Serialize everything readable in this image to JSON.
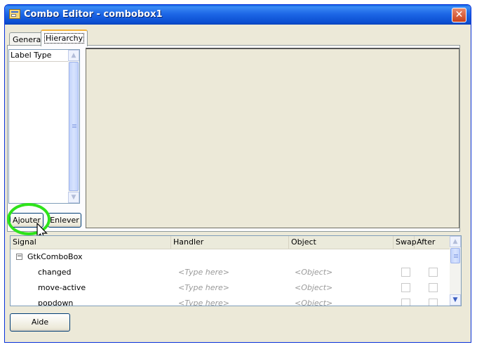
{
  "window": {
    "title": "Combo Editor - combobox1",
    "close_glyph": "✕"
  },
  "tabs": [
    {
      "label": "General",
      "selected": false
    },
    {
      "label": "Hierarchy",
      "selected": true
    }
  ],
  "label_list": {
    "header": "Label Type",
    "items": []
  },
  "buttons": {
    "add": "Ajouter",
    "remove": "Enlever",
    "help": "Aide"
  },
  "signals": {
    "columns": {
      "signal": "Signal",
      "handler": "Handler",
      "object": "Object",
      "swap": "Swap",
      "after": "After"
    },
    "group": "GtkComboBox",
    "rows": [
      {
        "signal": "changed",
        "handler": "<Type here>",
        "object": "<Object>"
      },
      {
        "signal": "move-active",
        "handler": "<Type here>",
        "object": "<Object>"
      },
      {
        "signal": "popdown",
        "handler": "<Type here>",
        "object": "<Object>"
      }
    ]
  },
  "icons": {
    "app": "combo-editor-icon",
    "close": "close-icon",
    "expander": "collapse-icon",
    "scroll_up": "scroll-up-icon",
    "scroll_down": "scroll-down-icon",
    "cursor": "mouse-cursor-icon"
  },
  "colors": {
    "titlebar": "#0b4ed1",
    "highlight_ring": "#2ee31b",
    "window_bg": "#ece9d8"
  }
}
